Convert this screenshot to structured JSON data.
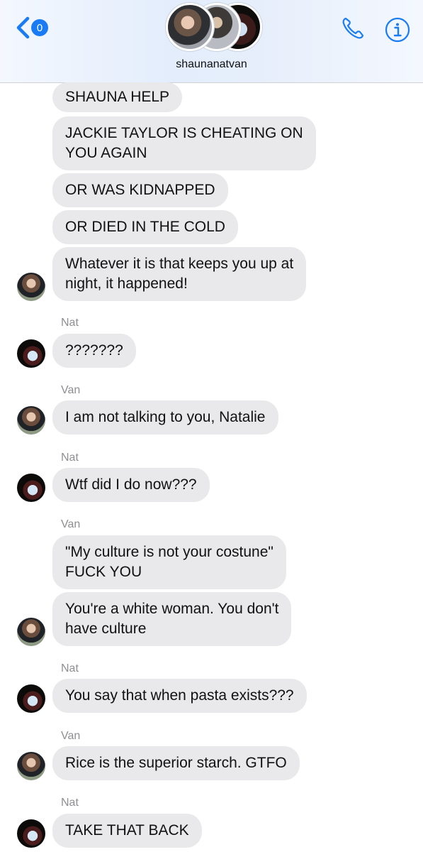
{
  "header": {
    "unread_count": "0",
    "conversation_name": "shaunanatvan"
  },
  "messages": [
    {
      "text": "SHAUNA HELP"
    },
    {
      "text": "JACKIE TAYLOR IS CHEATING ON",
      "text2": "YOU AGAIN"
    },
    {
      "text": "OR WAS KIDNAPPED"
    },
    {
      "text": "OR DIED IN THE COLD"
    },
    {
      "text": "Whatever it is that keeps you up at",
      "text2": "night, it happened!"
    },
    {
      "sender": "Nat",
      "text": "???????"
    },
    {
      "sender": "Van",
      "text": "I am not talking to you, Natalie"
    },
    {
      "sender": "Nat",
      "text": "Wtf did I do now???"
    },
    {
      "sender": "Van",
      "text": "\"My culture is not your costune\"",
      "text2": "FUCK YOU"
    },
    {
      "text": "You're a white woman. You don't",
      "text2": "have culture"
    },
    {
      "sender": "Nat",
      "text": "You say that when pasta exists???"
    },
    {
      "sender": "Van",
      "text": "Rice is the superior starch. GTFO"
    },
    {
      "sender": "Nat",
      "text": "TAKE THAT BACK"
    }
  ]
}
